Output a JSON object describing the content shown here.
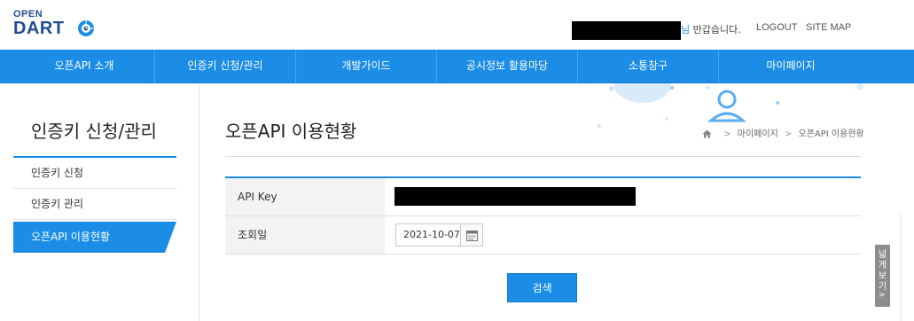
{
  "logo": {
    "line1": "OPEN",
    "line2": "DART"
  },
  "header": {
    "greeting_suffix": "님",
    "greeting": " 반갑습니다.",
    "logout": "LOGOUT",
    "sitemap": "SITE MAP"
  },
  "nav": {
    "items": [
      {
        "label": "오픈API 소개"
      },
      {
        "label": "인증키 신청/관리"
      },
      {
        "label": "개발가이드"
      },
      {
        "label": "공시정보 활용마당"
      },
      {
        "label": "소통창구"
      },
      {
        "label": "마이페이지"
      }
    ]
  },
  "sidebar": {
    "title": "인증키 신청/관리",
    "items": [
      {
        "label": "인증키 신청",
        "active": false
      },
      {
        "label": "인증키 관리",
        "active": false
      },
      {
        "label": "오픈API 이용현황",
        "active": true
      }
    ]
  },
  "main": {
    "title": "오픈API 이용현황",
    "breadcrumb": [
      "마이페이지",
      "오픈API 이용현황"
    ],
    "form": {
      "api_key_label": "API Key",
      "date_label": "조회일",
      "date_value": "2021-10-07"
    },
    "search_button": "검색"
  },
  "side_tab": {
    "label": "넓게보기",
    "arrow": ">"
  },
  "colors": {
    "accent": "#1b8de6",
    "brand_dark": "#1e4d8f"
  },
  "icons": [
    "dart-logo-icon",
    "home-icon",
    "calendar-icon",
    "person-icon"
  ]
}
